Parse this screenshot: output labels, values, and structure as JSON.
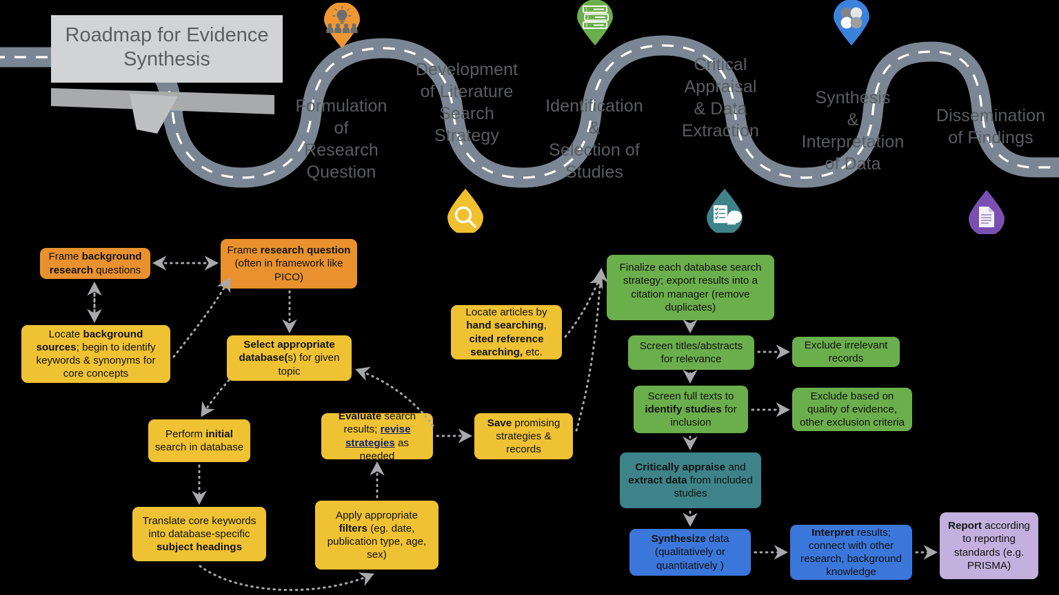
{
  "title": {
    "line1": "Roadmap for Evidence",
    "line2": "Synthesis"
  },
  "colors": {
    "road": "#7a8693",
    "orange": "#e8912e",
    "yellow": "#efc233",
    "green": "#6bae4c",
    "teal": "#3d8389",
    "blue": "#3b77db",
    "purple": "#c3b0de",
    "pin_orange": "#ef9833",
    "pin_yellow": "#f0c02e",
    "pin_green": "#6bae4c",
    "pin_blue": "#3b82dd",
    "pin_teal": "#3d8389",
    "pin_purple": "#7a4fb2",
    "label_text": "#595d60",
    "arrow": "#a7a9ac"
  },
  "roadmap": {
    "stages": [
      {
        "id": "formulation",
        "label": "Formulation\nof\nResearch\nQuestion"
      },
      {
        "id": "development",
        "label": "Development\nof Literature\nSearch\nStrategy"
      },
      {
        "id": "identification",
        "label": "Identification\n&\nSelection of\nStudies"
      },
      {
        "id": "appraisal",
        "label": "Critical\nAppraisal\n& Data\nExtraction"
      },
      {
        "id": "synthesis",
        "label": "Synthesis\n&\nInterpretation\nof Data"
      },
      {
        "id": "dissemination",
        "label": "Dissemination\nof Findings"
      }
    ],
    "pins": [
      {
        "id": "pin-formulation",
        "icon": "lightbulb-people-icon",
        "color": "#ef9833",
        "shape": "pin-up"
      },
      {
        "id": "pin-development",
        "icon": "magnifier-icon",
        "color": "#f0c02e",
        "shape": "drop-down"
      },
      {
        "id": "pin-identification",
        "icon": "database-list-icon",
        "color": "#6bae4c",
        "shape": "pin-up"
      },
      {
        "id": "pin-appraisal",
        "icon": "checklist-head-icon",
        "color": "#3d8389",
        "shape": "drop-down"
      },
      {
        "id": "pin-synthesis",
        "icon": "venn-circles-icon",
        "color": "#3b82dd",
        "shape": "pin-up"
      },
      {
        "id": "pin-dissemination",
        "icon": "document-icon",
        "color": "#7a4fb2",
        "shape": "drop-down"
      }
    ]
  },
  "flow": {
    "nodes": [
      {
        "id": "frame-background-questions",
        "color": "orange",
        "html": "Frame <b>background research</b> questions"
      },
      {
        "id": "frame-research-question",
        "color": "orange",
        "html": "Frame <b>research question</b> (often in framework like PICO)"
      },
      {
        "id": "locate-background-sources",
        "color": "yellow",
        "html": "Locate <b>background sources</b>; begin to identify keywords &amp; synonyms for core concepts"
      },
      {
        "id": "select-database",
        "color": "yellow",
        "html": "<b>Select appropriate database(</b>s) for given topic"
      },
      {
        "id": "perform-initial-search",
        "color": "yellow",
        "html": "Perform <b>initial</b> search in database"
      },
      {
        "id": "evaluate-search-results",
        "color": "yellow",
        "html": "<b>Evaluate</b> search results; <span class=\"lnk\">revise strategies</span> as needed"
      },
      {
        "id": "translate-keywords",
        "color": "yellow",
        "html": "Translate core keywords into database-specific <b>subject headings</b>"
      },
      {
        "id": "apply-filters",
        "color": "yellow",
        "html": "Apply appropriate <b>filters</b> (eg. date, publication type, age, sex)"
      },
      {
        "id": "locate-articles-hand-searching",
        "color": "yellow",
        "html": "Locate articles by <b>hand searching</b>, <b>cited reference searching,</b> etc."
      },
      {
        "id": "save-promising-strategies",
        "color": "yellow",
        "html": "<b>Save</b> promising strategies &amp; records"
      },
      {
        "id": "finalize-database-search",
        "color": "green",
        "html": "Finalize each database search strategy; export results into a citation manager (remove duplicates)"
      },
      {
        "id": "screen-titles-abstracts",
        "color": "green",
        "html": "Screen titles/abstracts for relevance"
      },
      {
        "id": "exclude-irrelevant-records",
        "color": "green",
        "html": "Exclude irrelevant records"
      },
      {
        "id": "screen-full-texts",
        "color": "green",
        "html": "Screen full texts to <b>identify studies</b> for inclusion"
      },
      {
        "id": "exclude-based-on-quality",
        "color": "green",
        "html": "Exclude based on quality of evidence, other exclusion criteria"
      },
      {
        "id": "critically-appraise",
        "color": "teal",
        "html": "<b>Critically appraise</b> and <b>extract data</b> from included studies"
      },
      {
        "id": "synthesize-data",
        "color": "blue",
        "html": "<b>Synthesize</b> data (qualitatively or quantitatively )"
      },
      {
        "id": "interpret-results",
        "color": "blue",
        "html": "<b>Interpret</b> results; connect with other research, background knowledge"
      },
      {
        "id": "report-standards",
        "color": "purple",
        "html": "<b>Report</b> according to reporting standards (e.g. PRISMA)"
      }
    ]
  }
}
